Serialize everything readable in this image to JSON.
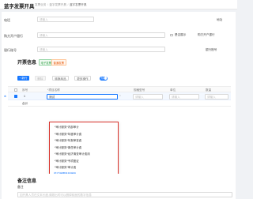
{
  "header": {
    "title": "蓝字发票开具",
    "crumbs": [
      "发票业务",
      "蓝字发票开具",
      "蓝字发票开具"
    ]
  },
  "buyer": {
    "phone_label": "电话",
    "phone_placeholder": "请输入",
    "bank_label": "购方开户银行",
    "bank_placeholder": "请输入",
    "bank_account_label": "银行账号",
    "bank_account_placeholder": "请输入",
    "show_label": "是否展示",
    "right_labels": [
      "地址",
      "购方开户银行",
      "银行账号"
    ],
    "right_placeholders": [
      "请输入",
      "请输入"
    ]
  },
  "lines": {
    "title": "开票信息",
    "tags": [
      "电子发票",
      "普通发票"
    ],
    "buttons": {
      "add_row": "+ 新行",
      "delete": "删除",
      "copy": "转换商品",
      "more": "更多操作"
    },
    "toggle_label": "含税",
    "columns": [
      "序号",
      "*项目名称",
      "规格型号",
      "单位",
      "数量"
    ],
    "row": {
      "index": "1",
      "item_value": "测试",
      "spec_placeholder": "请输入",
      "unit_placeholder": "请输入",
      "qty_placeholder": "请输入",
      "delete_link": "删除"
    },
    "total_label": "合计"
  },
  "dropdown": {
    "items": [
      "*审计服务*内部审计",
      "*审计服务*年度审计费",
      "*审计服务*年报审查费",
      "*审计服务*离任审计费",
      "*审计服务*经济清查审计费用",
      "*审计服务*专项鉴证",
      "*审计服务*审计费"
    ],
    "footer_link": "前往编辑商品编码"
  },
  "remark": {
    "title": "备注信息",
    "label": "备注",
    "placeholder": "如开具人员在文本长度,请超出时可以删掉前面的数字信息"
  }
}
